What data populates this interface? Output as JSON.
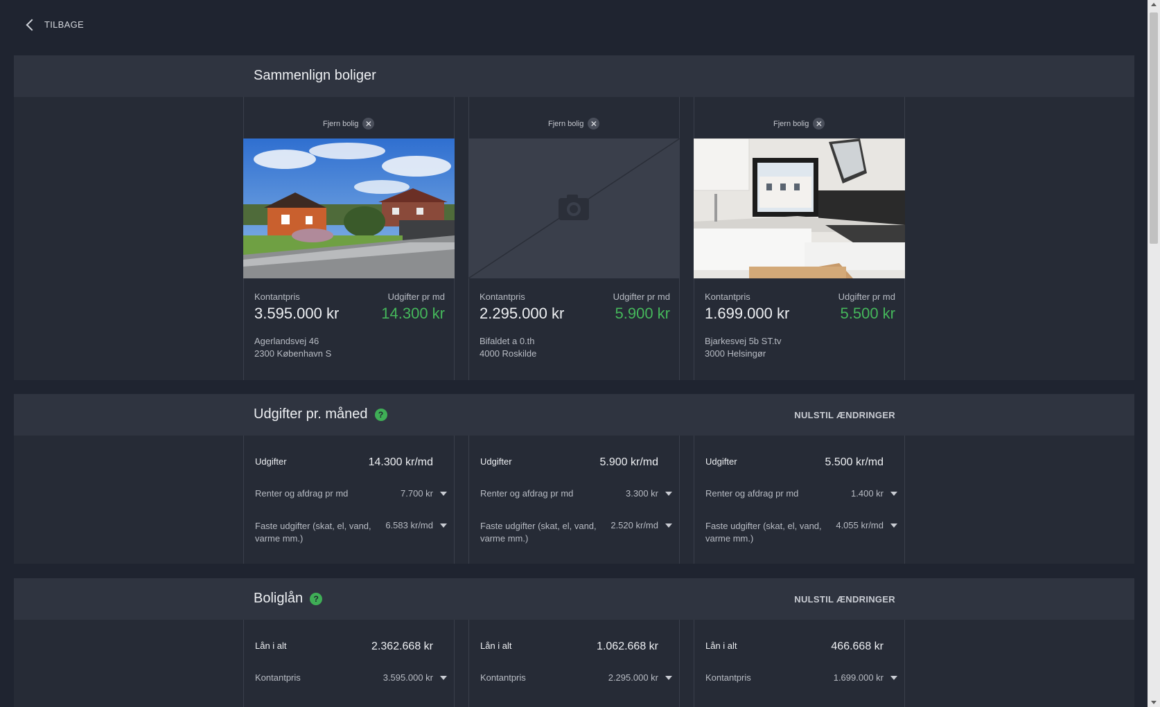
{
  "nav": {
    "back_label": "TILBAGE"
  },
  "compare": {
    "title": "Sammenlign boliger",
    "remove_label": "Fjern bolig",
    "price_label": "Kontantpris",
    "monthly_label": "Udgifter pr md",
    "homes": [
      {
        "price": "3.595.000 kr",
        "monthly": "14.300 kr",
        "street": "Agerlandsvej 46",
        "city": "2300 København S",
        "photo": "house-exterior"
      },
      {
        "price": "2.295.000 kr",
        "monthly": "5.900 kr",
        "street": "Bifaldet a 0.th",
        "city": "4000 Roskilde",
        "photo": "placeholder-camera"
      },
      {
        "price": "1.699.000 kr",
        "monthly": "5.500 kr",
        "street": "Bjarkesvej 5b ST.tv",
        "city": "3000 Helsingør",
        "photo": "kitchen-interior"
      }
    ]
  },
  "expenses": {
    "title": "Udgifter pr. måned",
    "reset_label": "NULSTIL ÆNDRINGER",
    "row_labels": {
      "total": "Udgifter",
      "interest": "Renter og afdrag pr md",
      "fixed": "Faste udgifter (skat, el, vand, varme mm.)"
    },
    "homes": [
      {
        "total": "14.300 kr/md",
        "interest": "7.700 kr",
        "fixed": "6.583 kr/md"
      },
      {
        "total": "5.900 kr/md",
        "interest": "3.300 kr",
        "fixed": "2.520 kr/md"
      },
      {
        "total": "5.500 kr/md",
        "interest": "1.400 kr",
        "fixed": "4.055 kr/md"
      }
    ]
  },
  "loan": {
    "title": "Boliglån",
    "reset_label": "NULSTIL ÆNDRINGER",
    "row_labels": {
      "total": "Lån i alt",
      "price": "Kontantpris"
    },
    "homes": [
      {
        "total": "2.362.668 kr",
        "price": "3.595.000 kr"
      },
      {
        "total": "1.062.668 kr",
        "price": "2.295.000 kr"
      },
      {
        "total": "466.668 kr",
        "price": "1.699.000 kr"
      }
    ]
  },
  "colors": {
    "accent_green": "#45b75b",
    "help_badge": "#3fae56",
    "background": "#1f2430"
  }
}
